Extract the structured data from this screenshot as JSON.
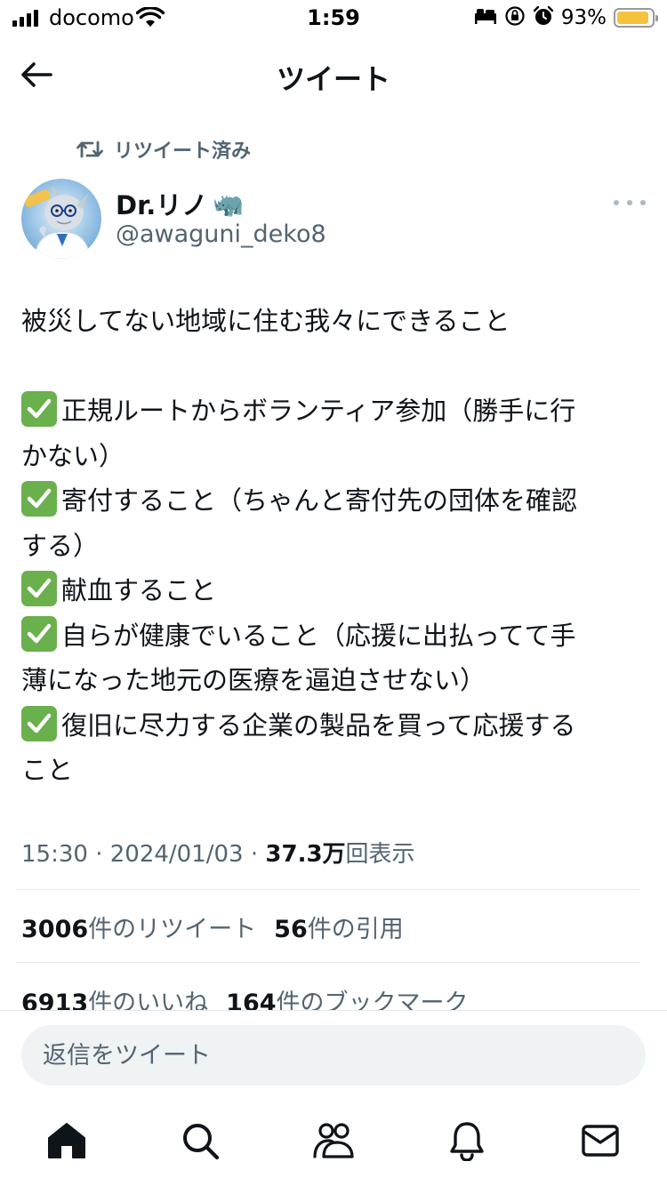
{
  "status_bar": {
    "carrier": "docomo",
    "time": "1:59",
    "battery_percent": "93%",
    "battery_level": 0.93,
    "battery_color": "#f5c33b"
  },
  "header": {
    "title": "ツイート",
    "back_icon": "arrow-left-icon"
  },
  "tweet": {
    "retweet_context": "リツイート済み",
    "author": {
      "name": "Dr.リノ",
      "name_emoji": "🦏",
      "handle": "@awaguni_deko8"
    },
    "text_lines": [
      "被災してない地域に住む我々にできること",
      "",
      "正規ルートからボランティア参加（勝手に行",
      "かない）",
      "寄付すること（ちゃんと寄付先の団体を確認",
      "する）",
      "献血すること",
      "自らが健康でいること（応援に出払ってて手",
      "薄になった地元の医療を逼迫させない）",
      "復旧に尽力する企業の製品を買って応援する",
      "こと"
    ],
    "meta": {
      "time": "15:30",
      "separator": "·",
      "date": "2024/01/03",
      "views_count": "37.3万",
      "views_label": "回表示"
    },
    "stats": {
      "retweets_count": "3006",
      "retweets_label": "件のリツイート",
      "quotes_count": "56",
      "quotes_label": "件の引用",
      "likes_count": "6913",
      "likes_label": "件のいいね",
      "bookmarks_count": "164",
      "bookmarks_label": "件のブックマーク"
    }
  },
  "reply": {
    "placeholder": "返信をツイート"
  },
  "tabbar": {
    "items": [
      "home-icon",
      "search-icon",
      "communities-icon",
      "notifications-icon",
      "messages-icon"
    ]
  },
  "colors": {
    "text_primary": "#0f1419",
    "text_secondary": "#536471",
    "check_green": "#6ab04c",
    "divider": "#e6e9ec"
  }
}
